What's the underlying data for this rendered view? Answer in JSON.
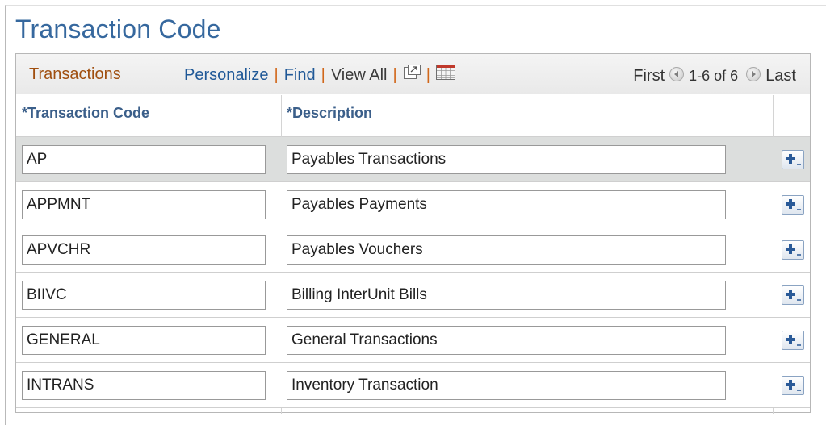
{
  "page": {
    "title": "Transaction Code"
  },
  "grid": {
    "caption": "Transactions",
    "toolbar": {
      "personalize": "Personalize",
      "find": "Find",
      "view_all": "View All",
      "sep": "|",
      "zoom_icon": "new-window-icon",
      "download_icon": "spreadsheet-icon"
    },
    "nav": {
      "first": "First",
      "range": "1-6 of 6",
      "last": "Last"
    },
    "columns": {
      "code": "*Transaction Code",
      "description": "*Description"
    },
    "rows": [
      {
        "code": "AP",
        "description": "Payables Transactions"
      },
      {
        "code": "APPMNT",
        "description": "Payables Payments"
      },
      {
        "code": "APVCHR",
        "description": "Payables Vouchers"
      },
      {
        "code": "BIIVC",
        "description": "Billing InterUnit Bills"
      },
      {
        "code": "GENERAL",
        "description": "General Transactions"
      },
      {
        "code": "INTRANS",
        "description": "Inventory Transaction"
      }
    ]
  },
  "colors": {
    "title": "#36689e",
    "caption": "#a04f10",
    "link": "#1f5897",
    "separator": "#d1671a",
    "column_header": "#3b5f8a",
    "active_row": "#dcdedd"
  }
}
